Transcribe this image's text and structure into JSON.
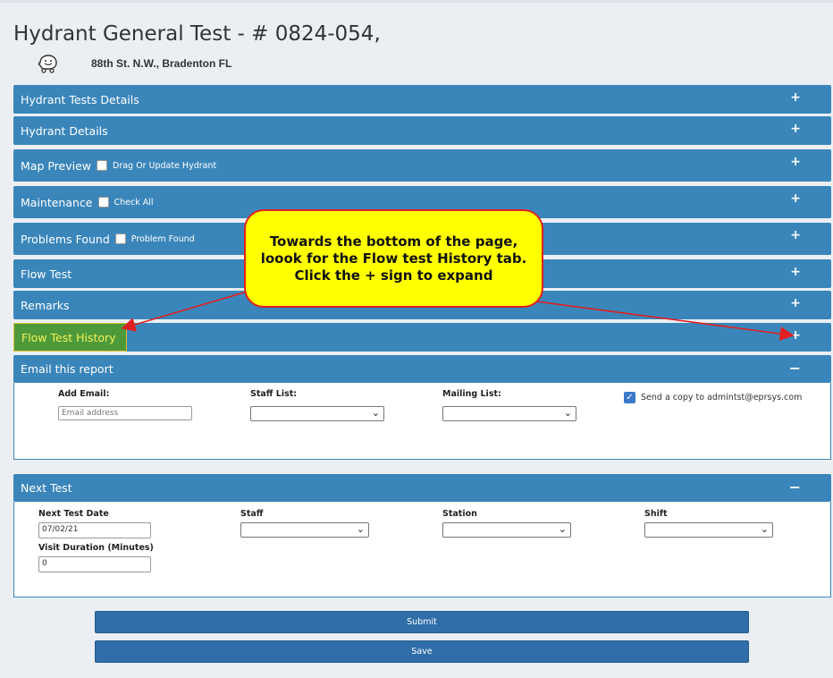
{
  "header": {
    "title": "Hydrant General Test - # 0824-054,",
    "address": "88th St. N.W., Bradenton FL",
    "nav_icon": "waze-icon"
  },
  "sections": {
    "hydrant_tests_details": "Hydrant Tests Details",
    "hydrant_details": "Hydrant Details",
    "map_preview": "Map Preview",
    "map_preview_checkbox": "Drag Or Update Hydrant",
    "maintenance": "Maintenance",
    "maintenance_checkbox": "Check All",
    "problems_found": "Problems Found",
    "problems_found_checkbox": "Problem Found",
    "flow_test": "Flow Test",
    "remarks": "Remarks",
    "flow_test_history": "Flow Test History",
    "email_report": "Email this report",
    "next_test": "Next Test",
    "expand_symbol": "+",
    "collapse_symbol": "−"
  },
  "email": {
    "add_email_label": "Add Email:",
    "email_placeholder": "Email address",
    "staff_list_label": "Staff List:",
    "mailing_list_label": "Mailing List:",
    "send_copy_label": "Send a copy to admintst@eprsys.com",
    "send_copy_checked": true
  },
  "next_test": {
    "date_label": "Next Test Date",
    "date_value": "07/02/21",
    "staff_label": "Staff",
    "station_label": "Station",
    "shift_label": "Shift",
    "duration_label": "Visit Duration (Minutes)",
    "duration_value": "0"
  },
  "buttons": {
    "submit": "Submit",
    "save": "Save"
  },
  "annotation": {
    "callout_text": "Towards the bottom of the page, loook for the Flow test History tab. Click the + sign to expand"
  },
  "colors": {
    "bar_blue": "#3a86bb",
    "highlight_green": "#4e9a3a",
    "callout_yellow": "#ffff00",
    "arrow_red": "#e02020"
  }
}
